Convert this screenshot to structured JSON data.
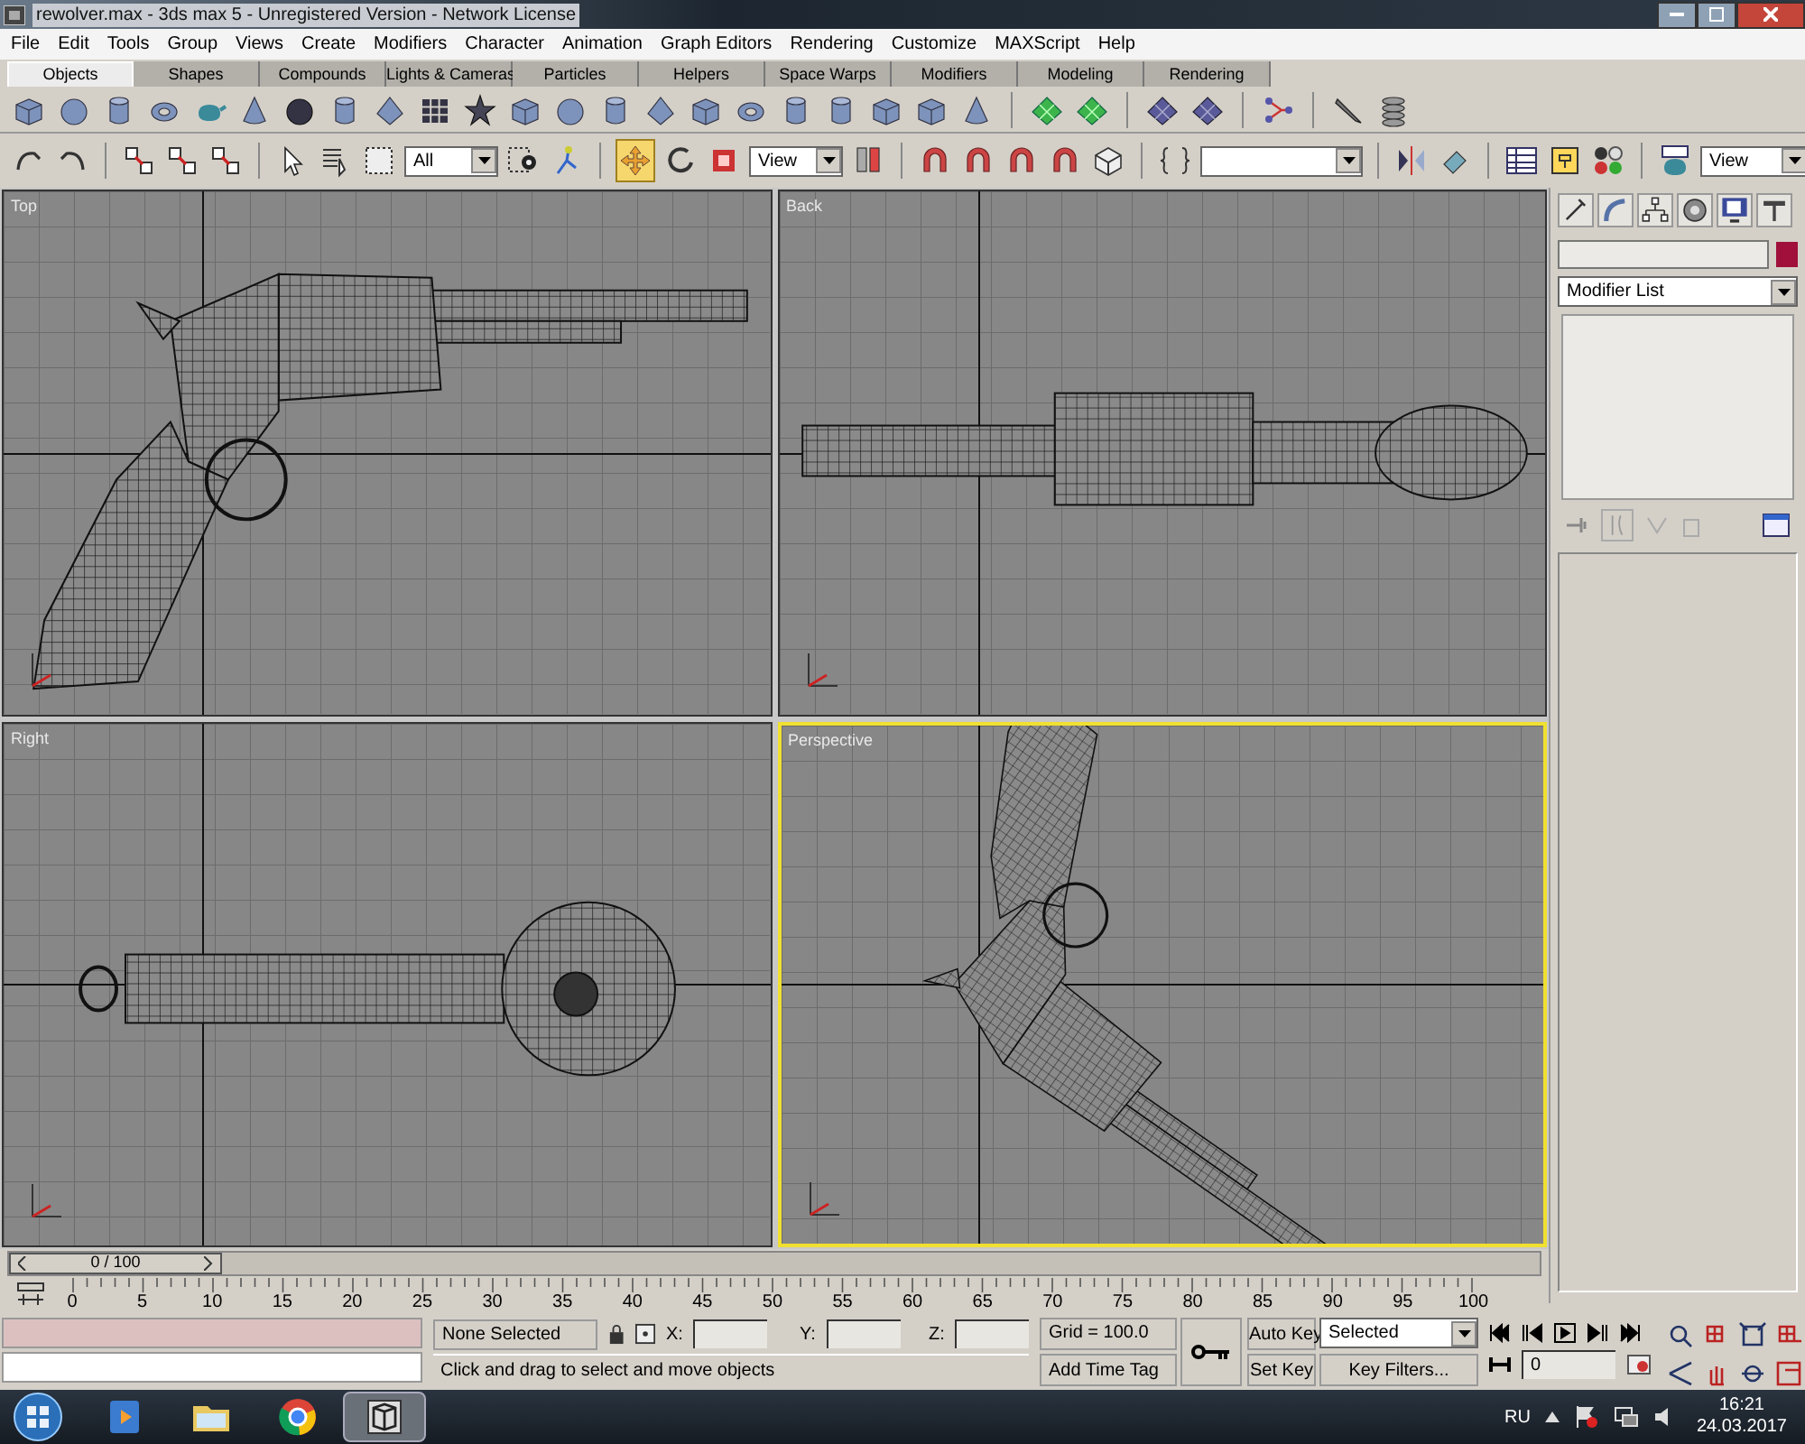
{
  "window": {
    "title": "rewolver.max - 3ds max 5 - Unregistered Version - Network License"
  },
  "menu": [
    "File",
    "Edit",
    "Tools",
    "Group",
    "Views",
    "Create",
    "Modifiers",
    "Character",
    "Animation",
    "Graph Editors",
    "Rendering",
    "Customize",
    "MAXScript",
    "Help"
  ],
  "tabs": [
    {
      "label": "Objects",
      "selected": true
    },
    {
      "label": "Shapes",
      "selected": false
    },
    {
      "label": "Compounds",
      "selected": false
    },
    {
      "label": "Lights & Cameras",
      "selected": false
    },
    {
      "label": "Particles",
      "selected": false
    },
    {
      "label": "Helpers",
      "selected": false
    },
    {
      "label": "Space Warps",
      "selected": false
    },
    {
      "label": "Modifiers",
      "selected": false
    },
    {
      "label": "Modeling",
      "selected": false
    },
    {
      "label": "Rendering",
      "selected": false
    }
  ],
  "main_toolbar": {
    "selection_filter": "All",
    "reference_coordinate": "View",
    "render_mode": "View",
    "move_tool": {
      "selected": true
    }
  },
  "viewports": [
    {
      "label": "Top",
      "kind": "side",
      "selected": false
    },
    {
      "label": "Back",
      "kind": "back",
      "selected": false
    },
    {
      "label": "Right",
      "kind": "right",
      "selected": false
    },
    {
      "label": "Perspective",
      "kind": "perspective",
      "selected": true
    }
  ],
  "command_panel": {
    "modifier_list": "Modifier List"
  },
  "time_slider": {
    "label": "0 / 100",
    "level": 0
  },
  "ruler": [
    "0",
    "5",
    "10",
    "15",
    "20",
    "25",
    "30",
    "35",
    "40",
    "45",
    "50",
    "55",
    "60",
    "65",
    "70",
    "75",
    "80",
    "85",
    "90",
    "95",
    "100"
  ],
  "status": {
    "selection": "None Selected",
    "x_label": "X:",
    "y_label": "Y:",
    "z_label": "Z:",
    "grid": "Grid = 100.0",
    "prompt": "Click and drag to select and move objects",
    "add_time_tag": "Add Time Tag"
  },
  "animation": {
    "auto_key": "Auto Key",
    "set_key": "Set Key",
    "key_mode": "Selected",
    "key_filters": "Key Filters...",
    "frame": "0"
  },
  "taskbar": {
    "apps": [
      {
        "kind": "media",
        "selected": false
      },
      {
        "kind": "folder",
        "selected": false
      },
      {
        "kind": "browser",
        "selected": false
      },
      {
        "kind": "max",
        "selected": true
      }
    ],
    "language": "RU",
    "time": "16:21",
    "date": "24.03.2017"
  }
}
